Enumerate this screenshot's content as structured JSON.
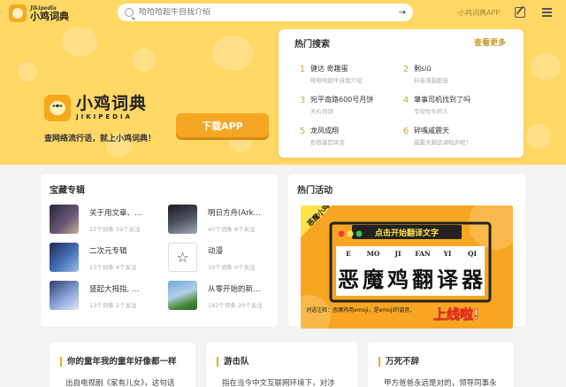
{
  "brand": {
    "sub": "Jikipedia",
    "name": "小鸡词典"
  },
  "search": {
    "placeholder": "哈哈哈超牛自我介绍"
  },
  "topbar": {
    "app_link": "小鸡词典APP"
  },
  "hero": {
    "logo_title": "小鸡词典",
    "logo_sub": "JIKIPEDIA",
    "slogan": "查网络流行语，就上小鸡词典！",
    "download_label": "下载APP",
    "bg_color": "#ffd866",
    "accent_color": "#f5a623"
  },
  "hot_search": {
    "title": "热门搜索",
    "more_label": "查看更多",
    "items": [
      {
        "rank": "1",
        "word": "健达 奇趣蛋",
        "desc": "哈哈哈超牛自我介绍"
      },
      {
        "rank": "2",
        "word": "剩siū",
        "desc": "抖音洗脑配音"
      },
      {
        "rank": "3",
        "word": "宛平南路600号月饼",
        "desc": "天价月饼"
      },
      {
        "rank": "4",
        "word": "肇事司机找到了吗",
        "desc": "专挖吹牛的人"
      },
      {
        "rank": "5",
        "word": "龙凤成翔",
        "desc": "形容基因突变"
      },
      {
        "rank": "6",
        "word": "碎嘴戚震天",
        "desc": "戚震天脚这讲啦声呢?"
      }
    ]
  },
  "collections": {
    "title": "宝藏专辑",
    "items": [
      {
        "name": "关于用文章、…",
        "meta": "22个词条  19个关注"
      },
      {
        "name": "明日方舟(Ark…",
        "meta": "40个词条  8个关注"
      },
      {
        "name": "二次元专辑",
        "meta": "13个词条  4个关注"
      },
      {
        "name": "动漫",
        "meta": "10个词条  0个关注"
      },
      {
        "name": "竖起大拇指, …",
        "meta": "13个词条  2个关注"
      },
      {
        "name": "从零开始的新…",
        "meta": "142个词条  20个关注"
      }
    ]
  },
  "activity": {
    "title": "热门活动",
    "banner": {
      "corner_tag": "恶魔小鸡",
      "tagline": "点击开始翻译文字",
      "pinyin": [
        "E",
        "MO",
        "JI",
        "FAN",
        "YI",
        "QI"
      ],
      "chars": [
        "恶",
        "魔",
        "鸡",
        "翻",
        "译",
        "器"
      ],
      "desc": "词语注释：恶魔鸡用emoji，是emoji的谐音。",
      "badge": "上线啦!"
    }
  },
  "articles": [
    {
      "title": "你的童年我的童年好像都一样",
      "excerpt": "出自电视剧《家有儿女》，这句话"
    },
    {
      "title": "游击队",
      "excerpt": "指在当今中文互联网环境下，对涉"
    },
    {
      "title": "万死不辞",
      "excerpt": "甲方爸爸永远是对的，领导同事永"
    }
  ]
}
